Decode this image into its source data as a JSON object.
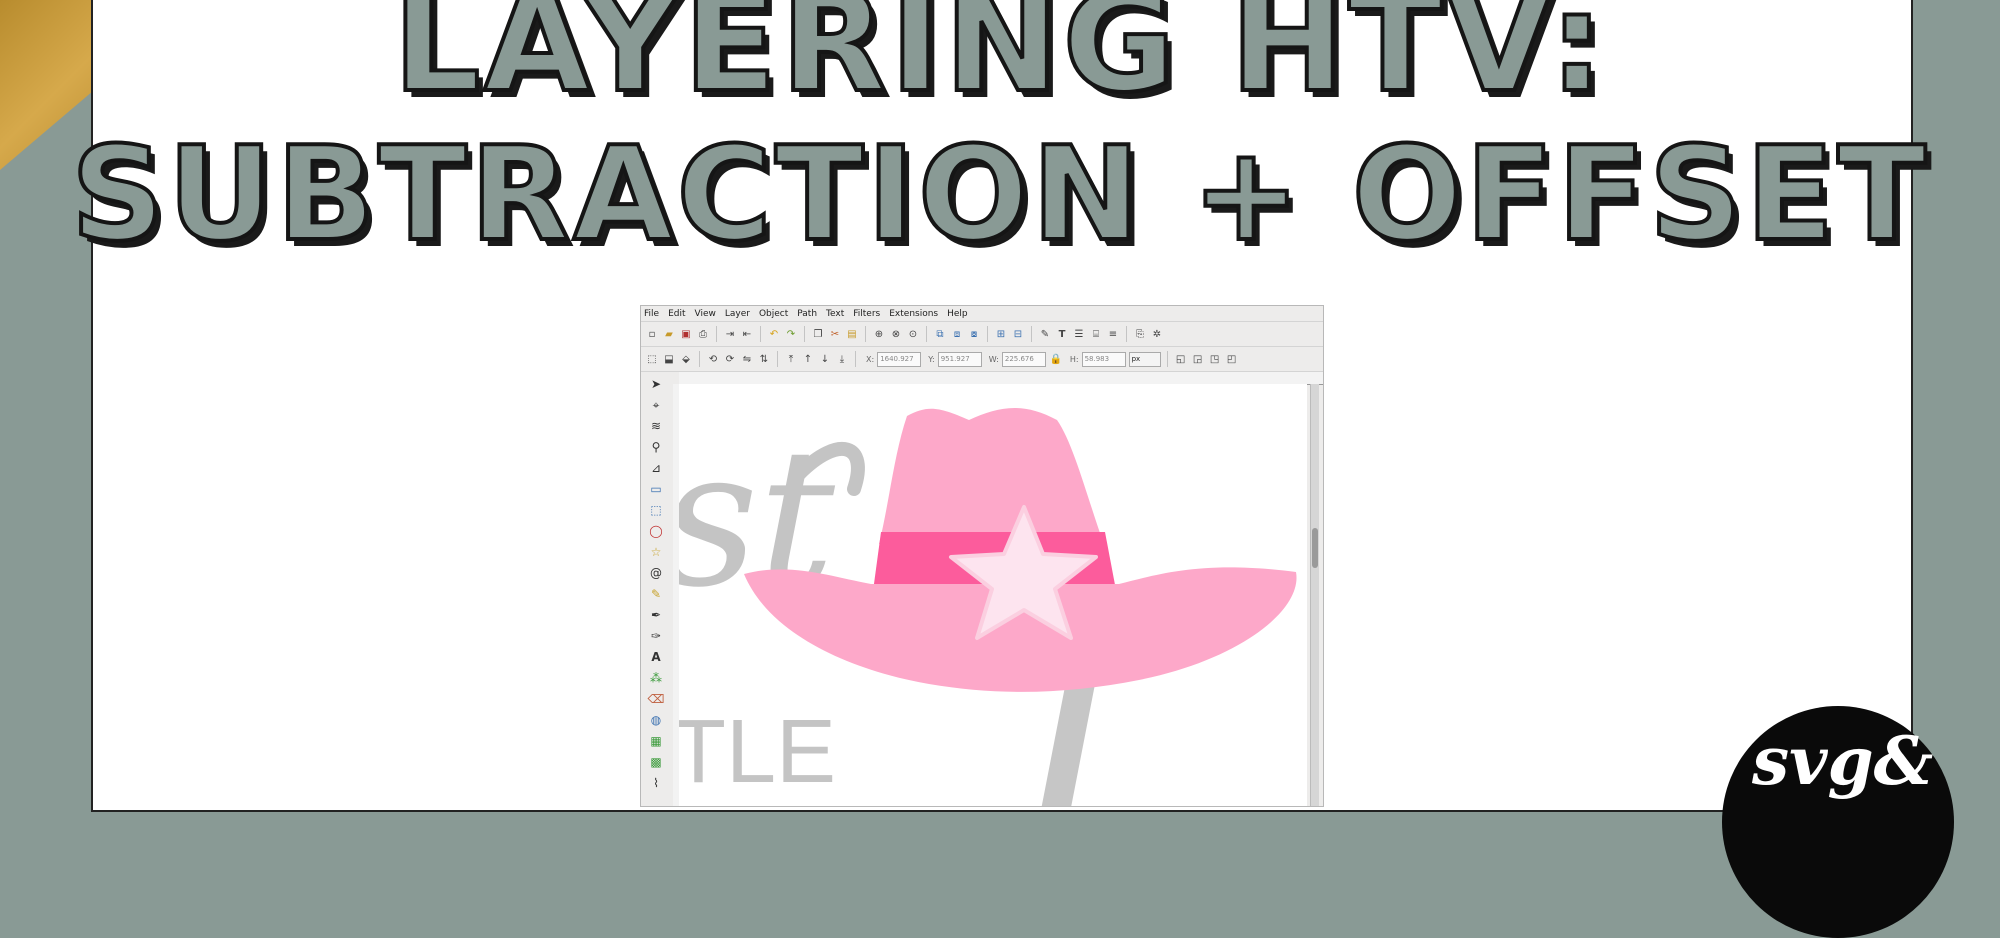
{
  "title": {
    "line1": "LAYERING HTV:",
    "line2": "SUBTRACTION + OFFSET"
  },
  "inkscape": {
    "menu": [
      "File",
      "Edit",
      "View",
      "Layer",
      "Object",
      "Path",
      "Text",
      "Filters",
      "Extensions",
      "Help"
    ],
    "controls": {
      "x_label": "X:",
      "x_value": "1640.927",
      "y_label": "Y:",
      "y_value": "951.927",
      "w_label": "W:",
      "w_value": "225.676",
      "h_label": "H:",
      "h_value": "58.983",
      "unit": "px"
    },
    "canvas_text": {
      "fragment_top": "st",
      "fragment_mid": "TLE",
      "fragment_script": "l"
    }
  },
  "badge": {
    "text": "svg&"
  },
  "colors": {
    "background_sage": "#899a95",
    "title_fill": "#899a95",
    "title_stroke": "#151515",
    "gold_corner": "#c89a3c",
    "hat_light_pink": "#fda8c9",
    "hat_band_pink": "#fc5c9c",
    "star_pale_pink": "#fde4ef",
    "ghost_gray": "#c4c4c4"
  },
  "icons": {
    "tools": [
      "selector-icon",
      "node-icon",
      "tweak-icon",
      "zoom-icon",
      "measure-icon",
      "rectangle-icon",
      "3d-box-icon",
      "ellipse-icon",
      "star-icon",
      "spiral-icon",
      "pencil-icon",
      "pen-icon",
      "calligraphy-icon",
      "text-icon",
      "spray-icon",
      "eraser-icon",
      "bucket-icon",
      "gradient-icon",
      "mesh-icon",
      "dropper-icon"
    ]
  }
}
